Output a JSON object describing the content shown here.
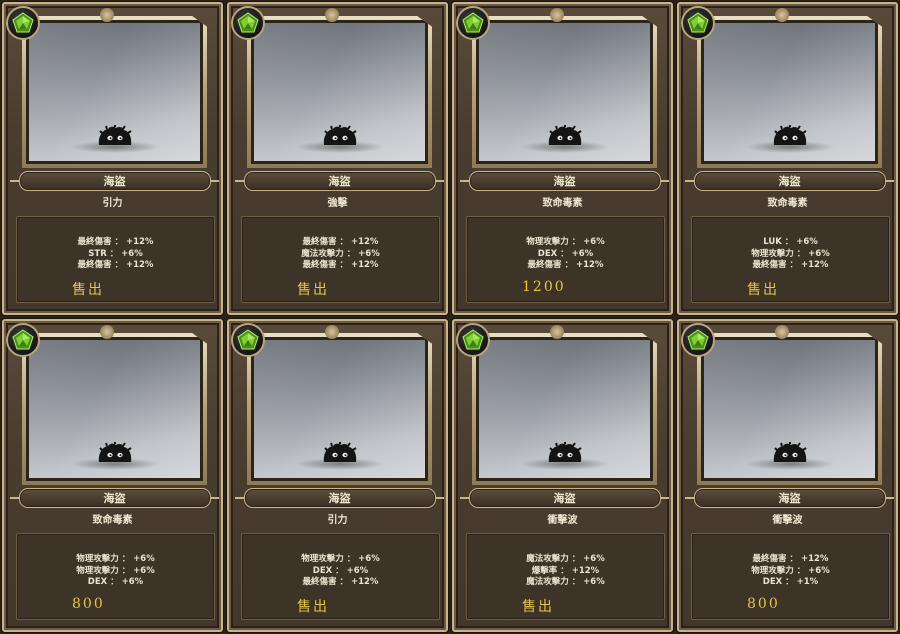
{
  "cards": [
    {
      "name": "海盜",
      "skill": "引力",
      "stats": [
        "最終傷害 ： +12%",
        "STR ： +6%",
        "最終傷害 ： +12%"
      ],
      "price": "售出"
    },
    {
      "name": "海盜",
      "skill": "強擊",
      "stats": [
        "最終傷害 ： +12%",
        "魔法攻擊力 ： +6%",
        "最終傷害 ： +12%"
      ],
      "price": "售出"
    },
    {
      "name": "海盜",
      "skill": "致命毒素",
      "stats": [
        "物理攻擊力 ： +6%",
        "DEX ： +6%",
        "最終傷害 ： +12%"
      ],
      "price": "1200"
    },
    {
      "name": "海盜",
      "skill": "致命毒素",
      "stats": [
        "LUK ： +6%",
        "物理攻擊力 ： +6%",
        "最終傷害 ： +12%"
      ],
      "price": "售出"
    },
    {
      "name": "海盜",
      "skill": "致命毒素",
      "stats": [
        "物理攻擊力 ： +6%",
        "物理攻擊力 ： +6%",
        "DEX ： +6%"
      ],
      "price": "800"
    },
    {
      "name": "海盜",
      "skill": "引力",
      "stats": [
        "物理攻擊力 ： +6%",
        "DEX ： +6%",
        "最終傷害 ： +12%"
      ],
      "price": "售出"
    },
    {
      "name": "海盜",
      "skill": "衝擊波",
      "stats": [
        "魔法攻擊力 ： +6%",
        "爆擊率 ： +12%",
        "魔法攻擊力 ： +6%"
      ],
      "price": "售出"
    },
    {
      "name": "海盜",
      "skill": "衝擊波",
      "stats": [
        "最終傷害 ： +12%",
        "物理攻擊力 ： +6%",
        "DEX ： +1%"
      ],
      "price": "800"
    }
  ],
  "colors": {
    "price": "#e2c64a",
    "gem": "#6fbf2a",
    "frame": "#c9b58c"
  },
  "icons": {
    "gem": "green-pentagon-gem-icon",
    "monster": "black-slime-monster-icon"
  }
}
